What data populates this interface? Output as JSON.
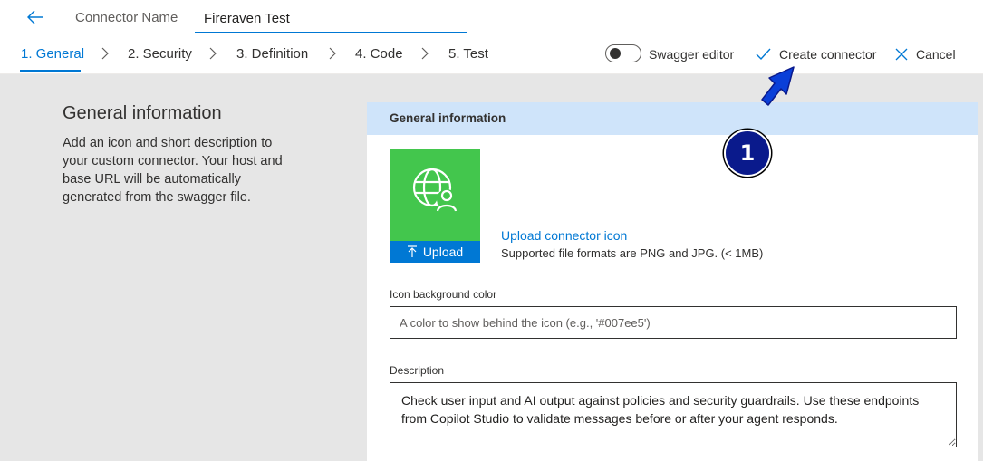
{
  "header": {
    "connector_name_label": "Connector Name",
    "connector_name_value": "Fireraven Test"
  },
  "steps": [
    {
      "label": "1. General",
      "active": true
    },
    {
      "label": "2. Security",
      "active": false
    },
    {
      "label": "3. Definition",
      "active": false
    },
    {
      "label": "4. Code",
      "active": false
    },
    {
      "label": "5. Test",
      "active": false
    }
  ],
  "toolbar": {
    "swagger_label": "Swagger editor",
    "swagger_enabled": false,
    "create_label": "Create connector",
    "cancel_label": "Cancel"
  },
  "left": {
    "title": "General information",
    "description": "Add an icon and short description to your custom connector. Your host and base URL will be automatically generated from the swagger file."
  },
  "panel": {
    "header": "General information",
    "upload_button": "Upload",
    "upload_link": "Upload connector icon",
    "upload_hint": "Supported file formats are PNG and JPG. (< 1MB)",
    "icon_bg_label": "Icon background color",
    "icon_bg_placeholder": "A color to show behind the icon (e.g., '#007ee5')",
    "description_label": "Description",
    "description_value": "Check user input and AI output against policies and security guardrails. Use these endpoints from Copilot Studio to validate messages before or after your agent responds."
  },
  "annotation": {
    "badge_number": "1"
  },
  "colors": {
    "accent": "#0078d4",
    "tile_green": "#43c64d",
    "panel_header": "#cfe4fa",
    "badge": "#0a1a8c"
  },
  "icons": [
    "back-arrow-icon",
    "chevron-right-icon",
    "checkmark-icon",
    "close-icon",
    "globe-user-icon",
    "upload-arrow-icon"
  ]
}
